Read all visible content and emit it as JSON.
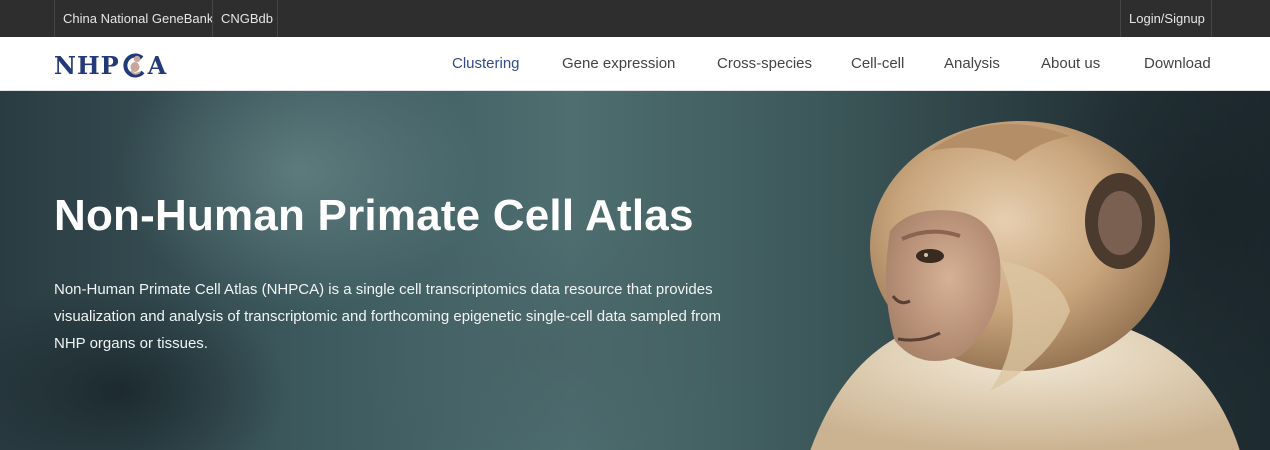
{
  "topbar": {
    "links": [
      "China National GeneBank",
      "CNGBdb"
    ],
    "login_label": "Login/Signup"
  },
  "navbar": {
    "logo_text_left": "NHP",
    "logo_text_right": "A",
    "items": [
      {
        "label": "Clustering",
        "active": true
      },
      {
        "label": "Gene expression",
        "active": false
      },
      {
        "label": "Cross-species",
        "active": false
      },
      {
        "label": "Cell-cell",
        "active": false
      },
      {
        "label": "Analysis",
        "active": false
      },
      {
        "label": "About us",
        "active": false
      },
      {
        "label": "Download",
        "active": false
      }
    ]
  },
  "hero": {
    "title": "Non-Human Primate Cell Atlas",
    "description": "Non-Human Primate Cell Atlas (NHPCA) is a single cell transcriptomics data resource that provides visualization and analysis of transcriptomic and forthcoming epigenetic single-cell data sampled from NHP organs or tissues."
  },
  "colors": {
    "topbar_bg": "#2e2e2e",
    "brand": "#233a78",
    "active_nav": "#2f4d8a"
  },
  "icons": {
    "logo": "monkey-logo-icon",
    "hero_image": "macaque-photo"
  }
}
